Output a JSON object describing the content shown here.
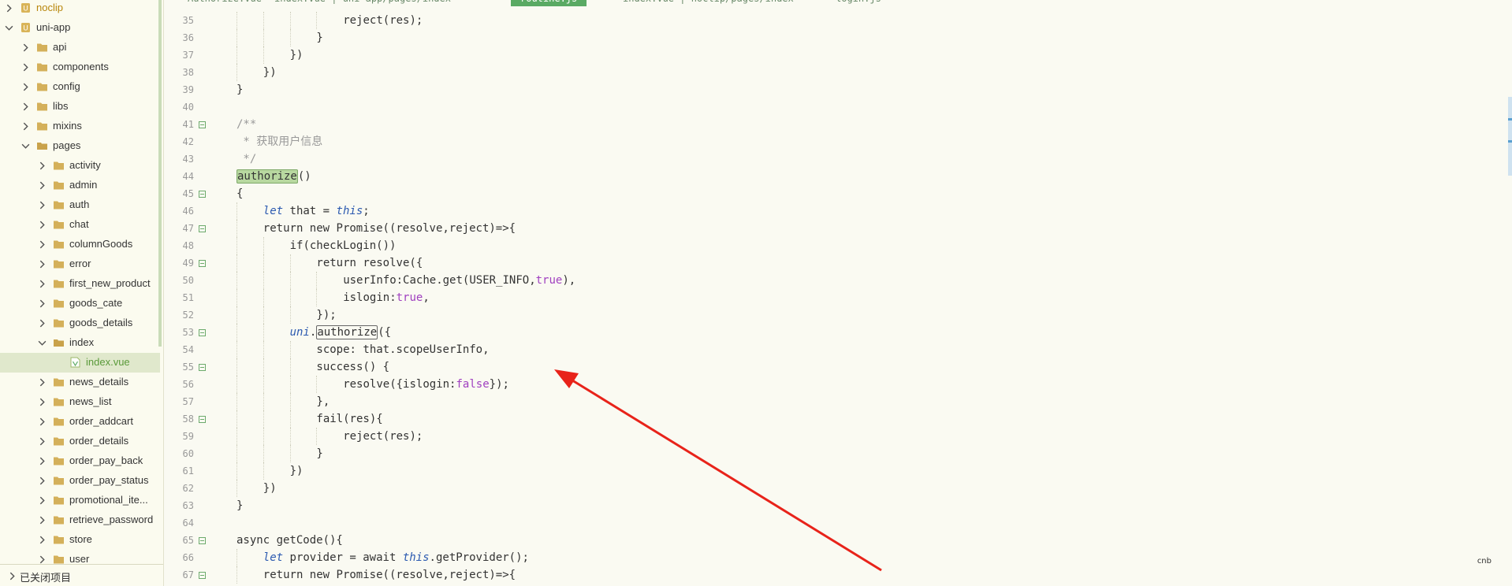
{
  "sidebar": {
    "items": [
      {
        "label": "noclip",
        "depth": 0,
        "expanded": false,
        "type": "project"
      },
      {
        "label": "uni-app",
        "depth": 0,
        "expanded": true,
        "type": "project"
      },
      {
        "label": "api",
        "depth": 1,
        "expanded": false,
        "type": "folder"
      },
      {
        "label": "components",
        "depth": 1,
        "expanded": false,
        "type": "folder"
      },
      {
        "label": "config",
        "depth": 1,
        "expanded": false,
        "type": "folder"
      },
      {
        "label": "libs",
        "depth": 1,
        "expanded": false,
        "type": "folder"
      },
      {
        "label": "mixins",
        "depth": 1,
        "expanded": false,
        "type": "folder"
      },
      {
        "label": "pages",
        "depth": 1,
        "expanded": true,
        "type": "folder"
      },
      {
        "label": "activity",
        "depth": 2,
        "expanded": false,
        "type": "folder"
      },
      {
        "label": "admin",
        "depth": 2,
        "expanded": false,
        "type": "folder"
      },
      {
        "label": "auth",
        "depth": 2,
        "expanded": false,
        "type": "folder"
      },
      {
        "label": "chat",
        "depth": 2,
        "expanded": false,
        "type": "folder"
      },
      {
        "label": "columnGoods",
        "depth": 2,
        "expanded": false,
        "type": "folder"
      },
      {
        "label": "error",
        "depth": 2,
        "expanded": false,
        "type": "folder"
      },
      {
        "label": "first_new_product",
        "depth": 2,
        "expanded": false,
        "type": "folder"
      },
      {
        "label": "goods_cate",
        "depth": 2,
        "expanded": false,
        "type": "folder"
      },
      {
        "label": "goods_details",
        "depth": 2,
        "expanded": false,
        "type": "folder"
      },
      {
        "label": "index",
        "depth": 2,
        "expanded": true,
        "type": "folder"
      },
      {
        "label": "index.vue",
        "depth": 3,
        "expanded": false,
        "type": "file",
        "selected": true
      },
      {
        "label": "news_details",
        "depth": 2,
        "expanded": false,
        "type": "folder"
      },
      {
        "label": "news_list",
        "depth": 2,
        "expanded": false,
        "type": "folder"
      },
      {
        "label": "order_addcart",
        "depth": 2,
        "expanded": false,
        "type": "folder"
      },
      {
        "label": "order_details",
        "depth": 2,
        "expanded": false,
        "type": "folder"
      },
      {
        "label": "order_pay_back",
        "depth": 2,
        "expanded": false,
        "type": "folder"
      },
      {
        "label": "order_pay_status",
        "depth": 2,
        "expanded": false,
        "type": "folder"
      },
      {
        "label": "promotional_ite...",
        "depth": 2,
        "expanded": false,
        "type": "folder"
      },
      {
        "label": "retrieve_password",
        "depth": 2,
        "expanded": false,
        "type": "folder"
      },
      {
        "label": "store",
        "depth": 2,
        "expanded": false,
        "type": "folder"
      },
      {
        "label": "user",
        "depth": 2,
        "expanded": false,
        "type": "folder"
      }
    ],
    "closed_projects_label": "已关闭项目"
  },
  "tabs": [
    {
      "label": "Authorize.vue",
      "active": false
    },
    {
      "label": "index.vue | uni-app/pages/index",
      "active": false
    },
    {
      "label": "routine.js",
      "active": true
    },
    {
      "label": "index.vue | noclip/pages/index",
      "active": false
    },
    {
      "label": "login.js",
      "active": false
    }
  ],
  "editor": {
    "lines": [
      {
        "n": 35,
        "fold": false,
        "indent": 4,
        "tokens": [
          [
            "plain",
            "reject(res);"
          ]
        ]
      },
      {
        "n": 36,
        "fold": false,
        "indent": 3,
        "tokens": [
          [
            "plain",
            "}"
          ]
        ]
      },
      {
        "n": 37,
        "fold": false,
        "indent": 2,
        "tokens": [
          [
            "plain",
            "})"
          ]
        ]
      },
      {
        "n": 38,
        "fold": false,
        "indent": 1,
        "tokens": [
          [
            "plain",
            "})"
          ]
        ]
      },
      {
        "n": 39,
        "fold": false,
        "indent": 0,
        "tokens": [
          [
            "plain",
            "}"
          ]
        ]
      },
      {
        "n": 40,
        "fold": false,
        "indent": 0,
        "tokens": []
      },
      {
        "n": 41,
        "fold": true,
        "indent": 0,
        "tokens": [
          [
            "comment",
            "/**"
          ]
        ]
      },
      {
        "n": 42,
        "fold": false,
        "indent": 0,
        "tokens": [
          [
            "comment",
            " * 获取用户信息"
          ]
        ]
      },
      {
        "n": 43,
        "fold": false,
        "indent": 0,
        "tokens": [
          [
            "comment",
            " */"
          ]
        ]
      },
      {
        "n": 44,
        "fold": false,
        "indent": 0,
        "tokens": [
          [
            "hlfill",
            "authorize"
          ],
          [
            "plain",
            "()"
          ]
        ]
      },
      {
        "n": 45,
        "fold": true,
        "indent": 0,
        "tokens": [
          [
            "plain",
            "{"
          ]
        ]
      },
      {
        "n": 46,
        "fold": false,
        "indent": 1,
        "tokens": [
          [
            "this",
            "let"
          ],
          [
            "plain",
            " that = "
          ],
          [
            "this",
            "this"
          ],
          [
            "plain",
            ";"
          ]
        ]
      },
      {
        "n": 47,
        "fold": true,
        "indent": 1,
        "tokens": [
          [
            "plain",
            "return new Promise((resolve,reject)=>{"
          ]
        ]
      },
      {
        "n": 48,
        "fold": false,
        "indent": 2,
        "tokens": [
          [
            "plain",
            "if(checkLogin())"
          ]
        ]
      },
      {
        "n": 49,
        "fold": true,
        "indent": 3,
        "tokens": [
          [
            "plain",
            "return resolve({"
          ]
        ]
      },
      {
        "n": 50,
        "fold": false,
        "indent": 4,
        "tokens": [
          [
            "plain",
            "userInfo:Cache.get(USER_INFO,"
          ],
          [
            "bool",
            "true"
          ],
          [
            "plain",
            "),"
          ]
        ]
      },
      {
        "n": 51,
        "fold": false,
        "indent": 4,
        "tokens": [
          [
            "plain",
            "islogin:"
          ],
          [
            "bool",
            "true"
          ],
          [
            "plain",
            ","
          ]
        ]
      },
      {
        "n": 52,
        "fold": false,
        "indent": 3,
        "tokens": [
          [
            "plain",
            "});"
          ]
        ]
      },
      {
        "n": 53,
        "fold": true,
        "indent": 2,
        "tokens": [
          [
            "this",
            "uni"
          ],
          [
            "plain",
            "."
          ],
          [
            "hlbox",
            "authorize"
          ],
          [
            "plain",
            "({"
          ]
        ]
      },
      {
        "n": 54,
        "fold": false,
        "indent": 3,
        "tokens": [
          [
            "plain",
            "scope: that.scopeUserInfo,"
          ]
        ]
      },
      {
        "n": 55,
        "fold": true,
        "indent": 3,
        "tokens": [
          [
            "plain",
            "success() {"
          ]
        ]
      },
      {
        "n": 56,
        "fold": false,
        "indent": 4,
        "tokens": [
          [
            "plain",
            "resolve({islogin:"
          ],
          [
            "bool",
            "false"
          ],
          [
            "plain",
            "});"
          ]
        ]
      },
      {
        "n": 57,
        "fold": false,
        "indent": 3,
        "tokens": [
          [
            "plain",
            "},"
          ]
        ]
      },
      {
        "n": 58,
        "fold": true,
        "indent": 3,
        "tokens": [
          [
            "plain",
            "fail(res){"
          ]
        ]
      },
      {
        "n": 59,
        "fold": false,
        "indent": 4,
        "tokens": [
          [
            "plain",
            "reject(res);"
          ]
        ]
      },
      {
        "n": 60,
        "fold": false,
        "indent": 3,
        "tokens": [
          [
            "plain",
            "}"
          ]
        ]
      },
      {
        "n": 61,
        "fold": false,
        "indent": 2,
        "tokens": [
          [
            "plain",
            "})"
          ]
        ]
      },
      {
        "n": 62,
        "fold": false,
        "indent": 1,
        "tokens": [
          [
            "plain",
            "})"
          ]
        ]
      },
      {
        "n": 63,
        "fold": false,
        "indent": 0,
        "tokens": [
          [
            "plain",
            "}"
          ]
        ]
      },
      {
        "n": 64,
        "fold": false,
        "indent": 0,
        "tokens": []
      },
      {
        "n": 65,
        "fold": true,
        "indent": 0,
        "tokens": [
          [
            "plain",
            "async getCode(){"
          ]
        ]
      },
      {
        "n": 66,
        "fold": false,
        "indent": 1,
        "tokens": [
          [
            "this",
            "let"
          ],
          [
            "plain",
            " provider = await "
          ],
          [
            "this",
            "this"
          ],
          [
            "plain",
            ".getProvider();"
          ]
        ]
      },
      {
        "n": 67,
        "fold": true,
        "indent": 1,
        "tokens": [
          [
            "plain",
            "return new Promise((resolve,reject)=>{"
          ]
        ]
      }
    ]
  },
  "annotation": {
    "type": "arrow",
    "color": "#e8231a"
  },
  "watermark": "cnb",
  "colors": {
    "sidebar_bg": "#fbfbef",
    "editor_bg": "#fafaf2",
    "active_tab": "#5aaa64",
    "selected_row": "#e0e8cc",
    "arrow": "#e8231a"
  },
  "icons": {
    "folder": "folder-icon",
    "file": "vue-file-icon",
    "project": "project-icon",
    "chevron": "chevron-icon"
  }
}
